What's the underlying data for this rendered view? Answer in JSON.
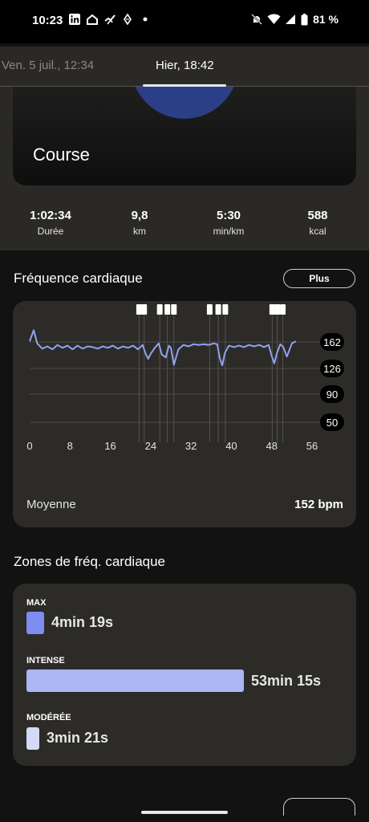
{
  "status_bar": {
    "time": "10:23",
    "battery": "81 %",
    "left_icons": [
      "linkedin-icon",
      "home-icon",
      "strava-icon",
      "diamond-icon",
      "dot-icon"
    ],
    "right_icons": [
      "mute-icon",
      "wifi-icon",
      "signal-icon",
      "battery-icon"
    ]
  },
  "tabs": {
    "previous": "Ven. 5 juil., 12:34",
    "active": "Hier, 18:42"
  },
  "activity": {
    "title": "Course",
    "stats": [
      {
        "value": "1:02:34",
        "label": "Durée"
      },
      {
        "value": "9,8",
        "label": "km"
      },
      {
        "value": "5:30",
        "label": "min/km"
      },
      {
        "value": "588",
        "label": "kcal"
      }
    ]
  },
  "heart_rate": {
    "title": "Fréquence cardiaque",
    "more_label": "Plus",
    "average_label": "Moyenne",
    "average_value": "152 bpm"
  },
  "chart_data": {
    "type": "line",
    "title": "",
    "xlabel": "",
    "ylabel": "",
    "x_ticks": [
      "0",
      "8",
      "16",
      "24",
      "32",
      "40",
      "48",
      "56"
    ],
    "y_ticks": [
      "162",
      "126",
      "90",
      "50"
    ],
    "xlim": [
      0,
      56
    ],
    "series": [
      {
        "color": "#8fa2f0",
        "x": [
          0,
          0.8,
          1.5,
          2.5,
          3.5,
          4.5,
          5.5,
          6.5,
          7.5,
          8.5,
          9.5,
          10.5,
          11.5,
          12.5,
          13.5,
          14.5,
          15.5,
          16.5,
          17.5,
          18.5,
          19.5,
          20.5,
          21.5,
          22.4,
          23,
          23.5,
          24,
          24.8,
          25.6,
          26.2,
          27,
          27.6,
          28,
          28.6,
          29.5,
          30.5,
          31.5,
          32.5,
          33.5,
          34.5,
          35.5,
          36.5,
          37.2,
          37.7,
          38.2,
          38.7,
          39.5,
          40.5,
          41.5,
          42.5,
          43.5,
          44.5,
          45.5,
          46.5,
          47.4,
          48,
          48.5,
          49,
          49.7,
          50.3,
          51,
          52,
          52.8
        ],
        "y": [
          163,
          178,
          160,
          153,
          156,
          152,
          158,
          154,
          157,
          152,
          157,
          153,
          156,
          155,
          153,
          156,
          154,
          157,
          153,
          156,
          154,
          157,
          152,
          158,
          146,
          139,
          146,
          154,
          160,
          145,
          141,
          157,
          154,
          131,
          152,
          158,
          156,
          159,
          158,
          159,
          158,
          160,
          159,
          140,
          130,
          147,
          157,
          155,
          157,
          155,
          158,
          156,
          158,
          155,
          158,
          143,
          133,
          146,
          159,
          155,
          142,
          160,
          163
        ]
      }
    ],
    "markers": [
      {
        "x": 21.7,
        "label": "pause"
      },
      {
        "x": 22.7,
        "label": "pause"
      },
      {
        "x": 25.8,
        "label": "pause"
      },
      {
        "x": 27.3,
        "label": "pause"
      },
      {
        "x": 28.6,
        "label": "pause"
      },
      {
        "x": 35.7,
        "label": "pause"
      },
      {
        "x": 37.4,
        "label": "pause"
      },
      {
        "x": 38.8,
        "label": "pause"
      },
      {
        "x": 48.1,
        "label": "pause"
      },
      {
        "x": 49.1,
        "label": "pause"
      },
      {
        "x": 50.2,
        "label": "pause"
      }
    ],
    "grid": true,
    "legend": "none"
  },
  "zones": {
    "title": "Zones de fréq. cardiaque",
    "items": [
      {
        "label": "MAX",
        "value": "4min 19s",
        "fraction": 0.08,
        "color": "#7f8cf0"
      },
      {
        "label": "INTENSE",
        "value": "53min 15s",
        "fraction": 1.0,
        "color": "#aab6f6"
      },
      {
        "label": "MODÉRÉE",
        "value": "3min 21s",
        "fraction": 0.06,
        "color": "#d3daf7"
      }
    ]
  }
}
